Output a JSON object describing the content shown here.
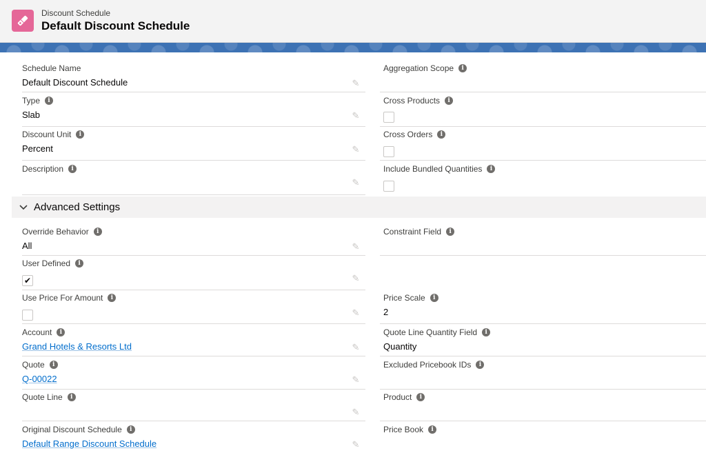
{
  "header": {
    "object_type": "Discount Schedule",
    "record_title": "Default Discount Schedule",
    "icon": "tag-icon"
  },
  "fields": {
    "schedule_name": {
      "label": "Schedule Name",
      "value": "Default Discount Schedule"
    },
    "type": {
      "label": "Type",
      "value": "Slab"
    },
    "discount_unit": {
      "label": "Discount Unit",
      "value": "Percent"
    },
    "description": {
      "label": "Description",
      "value": ""
    },
    "aggregation_scope": {
      "label": "Aggregation Scope",
      "value": ""
    },
    "cross_products": {
      "label": "Cross Products",
      "checked": false
    },
    "cross_orders": {
      "label": "Cross Orders",
      "checked": false
    },
    "include_bundled_quantities": {
      "label": "Include Bundled Quantities",
      "checked": false
    }
  },
  "advanced": {
    "section_title": "Advanced Settings",
    "override_behavior": {
      "label": "Override Behavior",
      "value": "All"
    },
    "user_defined": {
      "label": "User Defined",
      "checked": true
    },
    "use_price_for_amount": {
      "label": "Use Price For Amount",
      "checked": false
    },
    "account": {
      "label": "Account",
      "value": "Grand Hotels & Resorts Ltd"
    },
    "quote": {
      "label": "Quote",
      "value": "Q-00022"
    },
    "quote_line": {
      "label": "Quote Line",
      "value": ""
    },
    "original_discount_schedule": {
      "label": "Original Discount Schedule",
      "value": "Default Range Discount Schedule"
    },
    "constraint_field": {
      "label": "Constraint Field",
      "value": ""
    },
    "price_scale": {
      "label": "Price Scale",
      "value": "2"
    },
    "quote_line_quantity_field": {
      "label": "Quote Line Quantity Field",
      "value": "Quantity"
    },
    "excluded_pricebook_ids": {
      "label": "Excluded Pricebook IDs",
      "value": ""
    },
    "product": {
      "label": "Product",
      "value": ""
    },
    "price_book": {
      "label": "Price Book",
      "value": ""
    }
  },
  "colors": {
    "accent": "#e56798",
    "link": "#006dcc",
    "band": "#3d72b4"
  }
}
